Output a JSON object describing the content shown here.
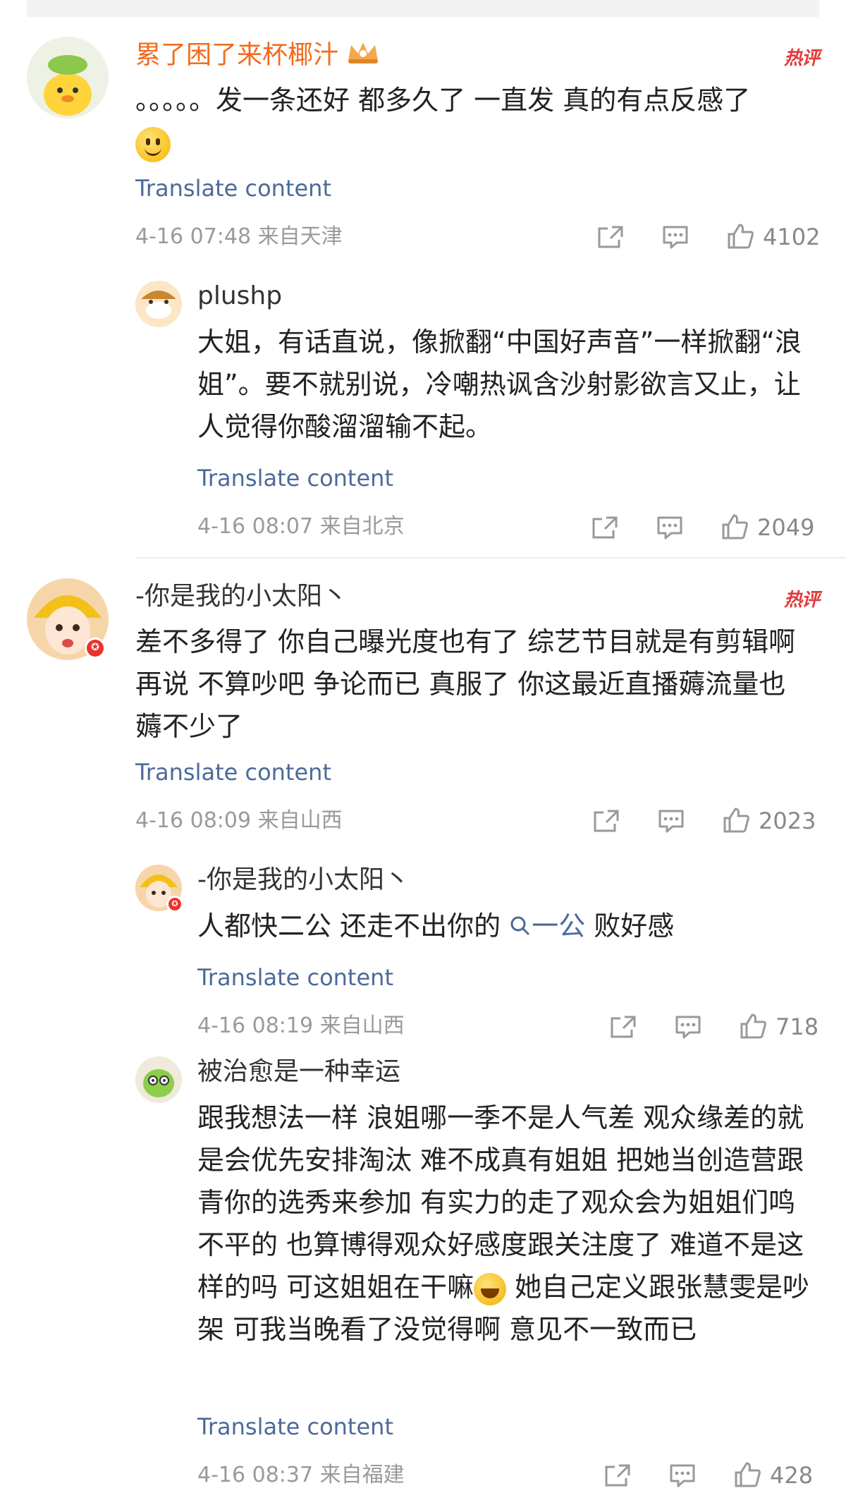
{
  "colors": {
    "accent": "#4c6a99",
    "username_vip": "#f26b1d",
    "hot": "#e03a3a",
    "meta": "#9a9a9a"
  },
  "comments": [
    {
      "username": "累了困了来杯椰汁",
      "hot_label": "热评",
      "text": "。。。。。发一条还好 都多久了 一直发 真的有点反感了",
      "translate": "Translate content",
      "time": "4-16 07:48",
      "location": "来自天津",
      "likes": "4102",
      "reply": {
        "username": "plushp",
        "text": "大姐，有话直说，像掀翻“中国好声音”一样掀翻“浪姐”。要不就别说，冷嘲热讽含沙射影欲言又止，让人觉得你酸溜溜输不起。",
        "translate": "Translate content",
        "time": "4-16 08:07",
        "location": "来自北京",
        "likes": "2049"
      }
    },
    {
      "username": "-你是我的小太阳丶",
      "hot_label": "热评",
      "text": "差不多得了 你自己曝光度也有了 综艺节目就是有剪辑啊 再说 不算吵吧 争论而已 真服了 你这最近直播薅流量也薅不少了",
      "translate": "Translate content",
      "time": "4-16 08:09",
      "location": "来自山西",
      "likes": "2023",
      "replies": [
        {
          "username": "-你是我的小太阳丶",
          "text_before": "人都快二公 还走不出你的",
          "topic": "一公",
          "text_after": " 败好感",
          "translate": "Translate content",
          "time": "4-16 08:19",
          "location": "来自山西",
          "likes": "718"
        },
        {
          "username": "被治愈是一种幸运",
          "text_before": "跟我想法一样 浪姐哪一季不是人气差  观众缘差的就是会优先安排淘汰  难不成真有姐姐 把她当创造营跟青你的选秀来参加   有实力的走了观众会为姐姐们鸣不平的  也算博得观众好感度跟关注度了 难道不是这样的吗 可这姐姐在干嘛",
          "text_after": " 她自己定义跟张慧雯是吵架  可我当晚看了没觉得啊  意见不一致而已",
          "translate": "Translate content",
          "time": "4-16 08:37",
          "location": "来自福建",
          "likes": "428"
        }
      ]
    }
  ]
}
